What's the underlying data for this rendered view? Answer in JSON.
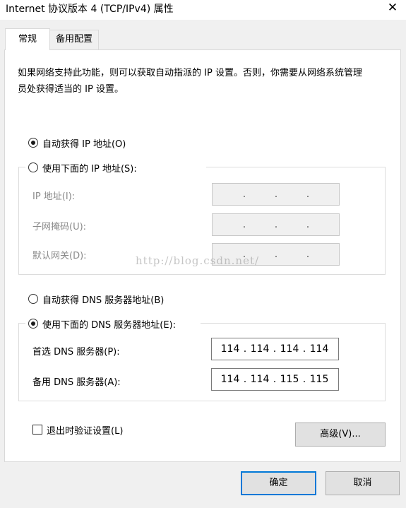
{
  "window": {
    "title": "Internet 协议版本 4 (TCP/IPv4) 属性",
    "close_icon": "close-icon"
  },
  "tabs": [
    {
      "label": "常规",
      "active": true
    },
    {
      "label": "备用配置",
      "active": false
    }
  ],
  "description": "如果网络支持此功能，则可以获取自动指派的 IP 设置。否则，你需要从网络系统管理员处获得适当的 IP 设置。",
  "ip": {
    "auto_label": "自动获得 IP 地址(O)",
    "auto_selected": true,
    "manual_label": "使用下面的 IP 地址(S):",
    "manual_selected": false,
    "fields": [
      {
        "label": "IP 地址(I):",
        "octets": [
          "",
          "",
          "",
          ""
        ]
      },
      {
        "label": "子网掩码(U):",
        "octets": [
          "",
          "",
          "",
          ""
        ]
      },
      {
        "label": "默认网关(D):",
        "octets": [
          "",
          "",
          "",
          ""
        ]
      }
    ]
  },
  "dns": {
    "auto_label": "自动获得 DNS 服务器地址(B)",
    "auto_selected": false,
    "manual_label": "使用下面的 DNS 服务器地址(E):",
    "manual_selected": true,
    "fields": [
      {
        "label": "首选 DNS 服务器(P):",
        "octets": [
          "114",
          "114",
          "114",
          "114"
        ]
      },
      {
        "label": "备用 DNS 服务器(A):",
        "octets": [
          "114",
          "114",
          "115",
          "115"
        ]
      }
    ]
  },
  "validate": {
    "label": "退出时验证设置(L)",
    "checked": false
  },
  "buttons": {
    "advanced": "高级(V)...",
    "ok": "确定",
    "cancel": "取消"
  },
  "watermark": "http://blog.csdn.net/",
  "colors": {
    "accent": "#0078d7",
    "panel": "#ffffff",
    "window": "#f0f0f0"
  }
}
